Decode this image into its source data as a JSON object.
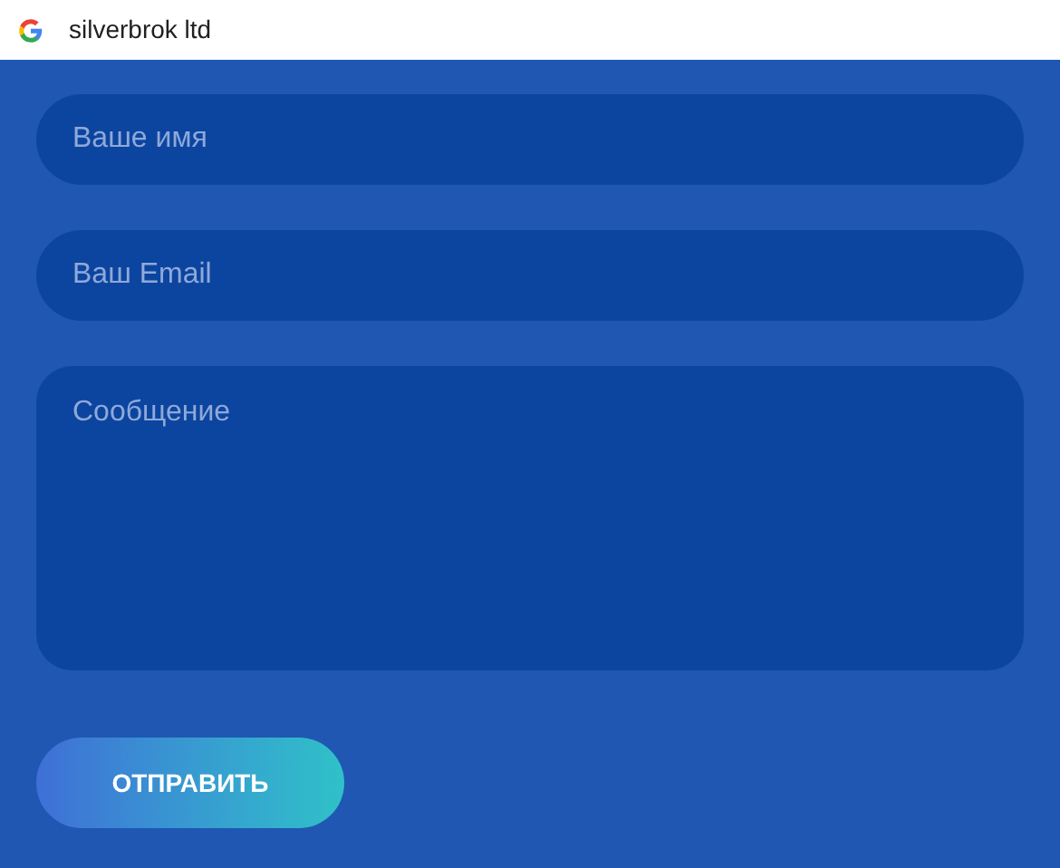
{
  "header": {
    "title": "silverbrok ltd"
  },
  "fields": [
    {
      "kind": "input",
      "placeholder": "Ваше имя"
    },
    {
      "kind": "input",
      "placeholder": "Ваш Email"
    },
    {
      "kind": "textarea",
      "placeholder": "Сообщение"
    }
  ],
  "submit": {
    "label": "ОТПРАВИТЬ"
  }
}
